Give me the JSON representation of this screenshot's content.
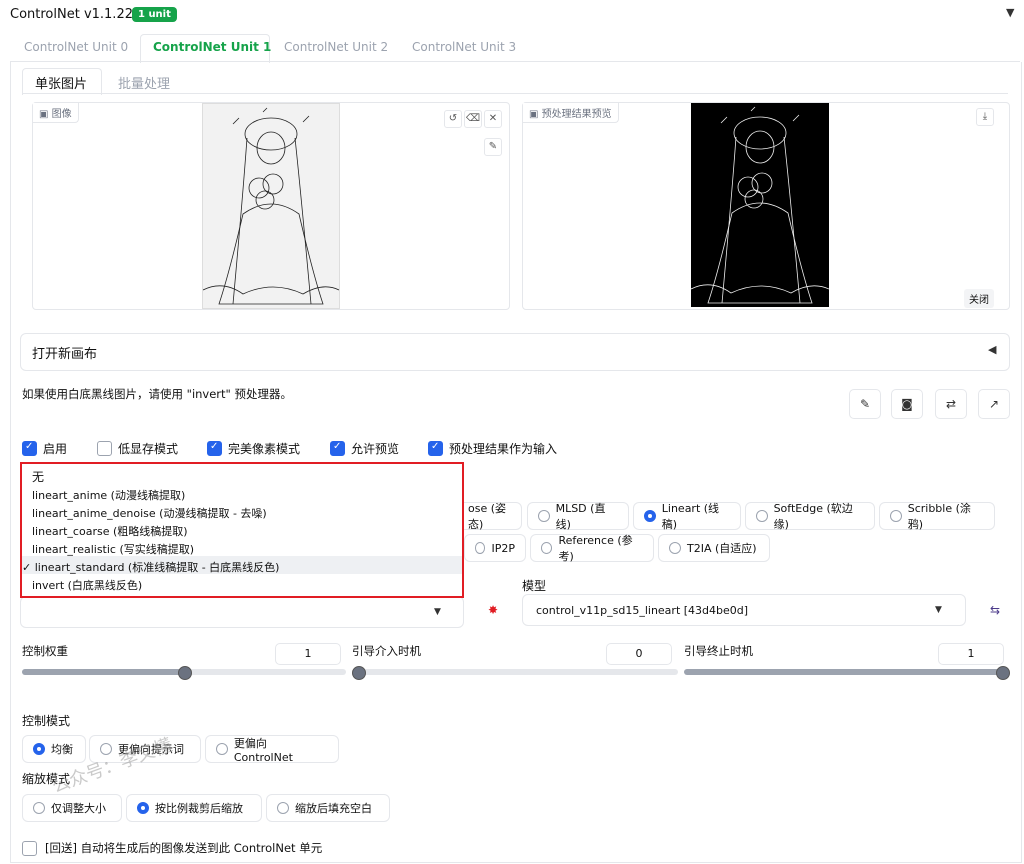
{
  "header": {
    "title": "ControlNet v1.1.224",
    "badge": "1 unit",
    "collapse_icon": "▼"
  },
  "unit_tabs": [
    "ControlNet Unit 0",
    "ControlNet Unit 1",
    "ControlNet Unit 2",
    "ControlNet Unit 3"
  ],
  "sub_tabs": [
    "单张图片",
    "批量处理"
  ],
  "image_panel": {
    "label": "图像"
  },
  "preview_panel": {
    "label": "预处理结果预览",
    "close_label": "关闭"
  },
  "canvas_accordion": {
    "title": "打开新画布",
    "caret": "◀"
  },
  "hint": "如果使用白底黑线图片，请使用 \"invert\" 预处理器。",
  "checkboxes": [
    {
      "label": "启用",
      "checked": true
    },
    {
      "label": "低显存模式",
      "checked": false
    },
    {
      "label": "完美像素模式",
      "checked": true
    },
    {
      "label": "允许预览",
      "checked": true
    },
    {
      "label": "预处理结果作为输入",
      "checked": true
    }
  ],
  "preprocessor_dropdown": {
    "options": [
      "无",
      "lineart_anime (动漫线稿提取)",
      "lineart_anime_denoise (动漫线稿提取 - 去噪)",
      "lineart_coarse (粗略线稿提取)",
      "lineart_realistic (写实线稿提取)",
      "✓ lineart_standard (标准线稿提取 - 白底黑线反色)",
      "invert (白底黑线反色)"
    ],
    "selected_index": 5
  },
  "control_types_row1": [
    {
      "label": "ose (姿态)",
      "selected": false
    },
    {
      "label": "MLSD (直线)",
      "selected": false
    },
    {
      "label": "Lineart (线稿)",
      "selected": true
    },
    {
      "label": "SoftEdge (软边缘)",
      "selected": false
    },
    {
      "label": "Scribble (涂鸦)",
      "selected": false
    }
  ],
  "control_types_row2": [
    {
      "label": "IP2P",
      "selected": false
    },
    {
      "label": "Reference (参考)",
      "selected": false
    },
    {
      "label": "T2IA (自适应)",
      "selected": false
    }
  ],
  "model": {
    "label": "模型",
    "value": "control_v11p_sd15_lineart [43d4be0d]"
  },
  "sliders": [
    {
      "label": "控制权重",
      "value": "1",
      "fraction": 0.5
    },
    {
      "label": "引导介入时机",
      "value": "0",
      "fraction": 0.0
    },
    {
      "label": "引导终止时机",
      "value": "1",
      "fraction": 1.0
    }
  ],
  "control_mode": {
    "label": "控制模式",
    "options": [
      {
        "label": "均衡",
        "selected": true
      },
      {
        "label": "更偏向提示词",
        "selected": false
      },
      {
        "label": "更偏向 ControlNet",
        "selected": false
      }
    ]
  },
  "resize_mode": {
    "label": "缩放模式",
    "options": [
      {
        "label": "仅调整大小",
        "selected": false
      },
      {
        "label": "按比例裁剪后缩放",
        "selected": true
      },
      {
        "label": "缩放后填充空白",
        "selected": false
      }
    ]
  },
  "loopback": {
    "label": "[回送] 自动将生成后的图像发送到此 ControlNet 单元",
    "checked": false
  },
  "watermark": "公众号：李又懂",
  "colors": {
    "accent": "#2563eb",
    "tab_active": "#16a34a",
    "highlight_border": "#e11d24"
  }
}
